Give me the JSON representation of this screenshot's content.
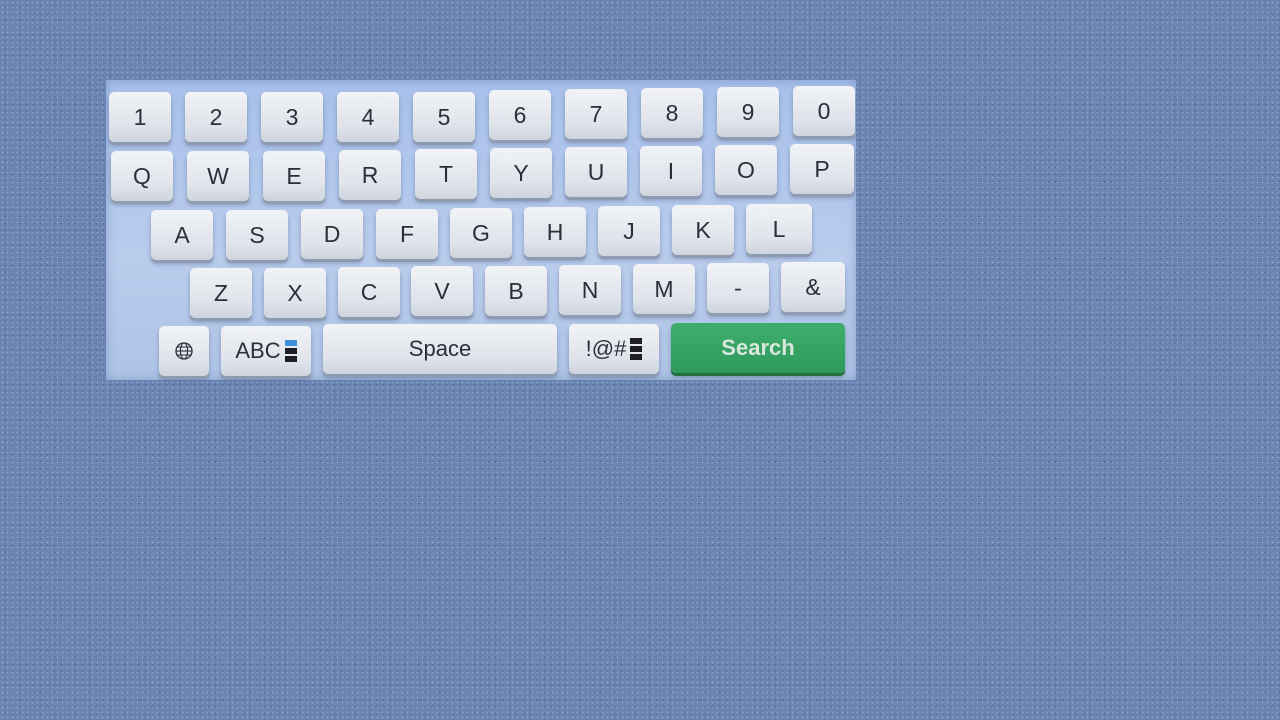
{
  "keyboard": {
    "row_numbers": [
      "1",
      "2",
      "3",
      "4",
      "5",
      "6",
      "7",
      "8",
      "9",
      "0"
    ],
    "row_qwerty": [
      "Q",
      "W",
      "E",
      "R",
      "T",
      "Y",
      "U",
      "I",
      "O",
      "P"
    ],
    "row_home": [
      "A",
      "S",
      "D",
      "F",
      "G",
      "H",
      "J",
      "K",
      "L"
    ],
    "row_bottom": [
      "Z",
      "X",
      "C",
      "V",
      "B",
      "N",
      "M",
      "-",
      "&"
    ],
    "function_row": {
      "language_icon": "globe-icon",
      "abc_label": "ABC",
      "space_label": "Space",
      "symbols_label": "!@#",
      "search_label": "Search"
    }
  },
  "colors": {
    "background": "#6a85b4",
    "keyboard_panel": "#b3c7ea",
    "key_face": "#e4e7ed",
    "search_key": "#35a363"
  }
}
